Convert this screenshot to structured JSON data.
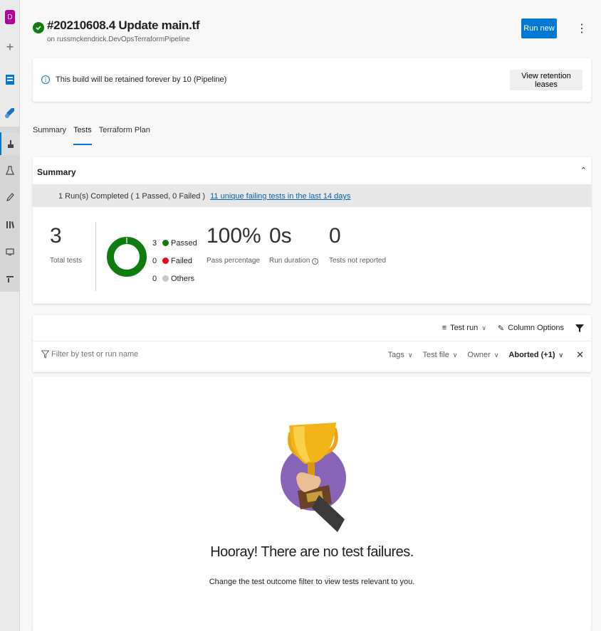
{
  "rail": {
    "org_initial": "D",
    "items": [
      "plus-icon",
      "boards-icon",
      "pipelines-icon",
      "builds-icon",
      "flask-icon",
      "rocket-icon",
      "library-icon",
      "monitor-icon",
      "task-groups-icon"
    ]
  },
  "header": {
    "title": "#20210608.4 Update main.tf",
    "subtitle": "on russmckendrick.DevOpsTerraformPipeline",
    "run_button": "Run new",
    "more": "⋮"
  },
  "retention": {
    "message": "This build will be retained forever by 10 (Pipeline)",
    "button": "View retention leases"
  },
  "tabs": [
    "Summary",
    "Tests",
    "Terraform Plan"
  ],
  "active_tab": "Tests",
  "summary": {
    "heading": "Summary",
    "runs_text": "1 Run(s) Completed ( 1 Passed, 0 Failed )",
    "failing_link": "11 unique failing tests in the last 14 days",
    "total_tests": "3",
    "total_label": "Total tests",
    "legend": [
      {
        "count": "3",
        "label": "Passed",
        "color": "#107c10"
      },
      {
        "count": "0",
        "label": "Failed",
        "color": "#e00b1c"
      },
      {
        "count": "0",
        "label": "Others",
        "color": "#c8c8c8"
      }
    ],
    "pass_percentage": "100%",
    "pass_label": "Pass percentage",
    "run_duration": "0s",
    "duration_label": "Run duration",
    "not_reported": "0",
    "not_reported_label": "Tests not reported"
  },
  "toolbar": {
    "test_run": "Test run",
    "column_options": "Column Options"
  },
  "filters": {
    "placeholder": "Filter by test or run name",
    "tags": "Tags",
    "test_file": "Test file",
    "owner": "Owner",
    "outcome": "Aborted (+1)"
  },
  "empty_state": {
    "title": "Hooray! There are no test failures.",
    "hint": "Change the test outcome filter to view tests relevant to you."
  },
  "colors": {
    "accent": "#0078d4",
    "success": "#107c10",
    "failure": "#e00b1c",
    "trophy_bg": "#8764b8"
  }
}
